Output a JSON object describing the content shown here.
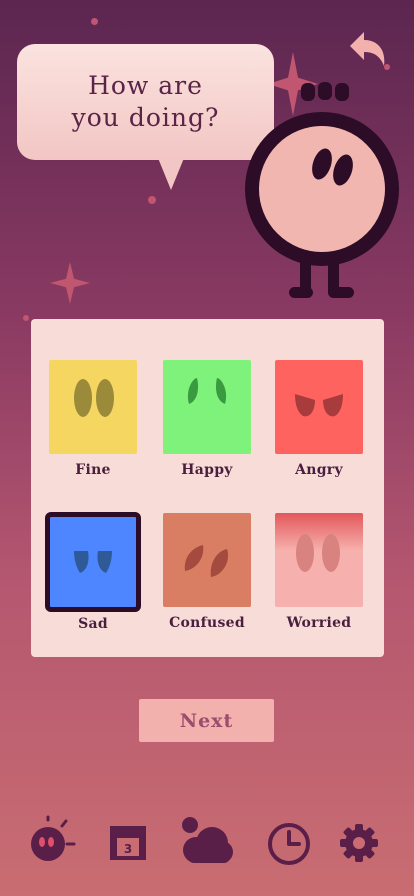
{
  "prompt": {
    "question": "How are you doing?"
  },
  "moods": [
    {
      "label": "Fine",
      "color": "#f5d660",
      "eye_color": "#9b8a3a",
      "icon": "fine-face-icon",
      "selected": false
    },
    {
      "label": "Happy",
      "color": "#7ef27a",
      "eye_color": "#3a9a40",
      "icon": "happy-face-icon",
      "selected": false
    },
    {
      "label": "Angry",
      "color": "#ff6360",
      "eye_color": "#a83c3c",
      "icon": "angry-face-icon",
      "selected": false
    },
    {
      "label": "Sad",
      "color": "#4d86ff",
      "eye_color": "#2f5a98",
      "icon": "sad-face-icon",
      "selected": true
    },
    {
      "label": "Confused",
      "color": "#d97e62",
      "eye_color": "#a44a3e",
      "icon": "confused-face-icon",
      "selected": false
    },
    {
      "label": "Worried",
      "color": "#f6b1ae",
      "eye_color": "#d8837f",
      "icon": "worried-face-icon",
      "selected": false
    }
  ],
  "actions": {
    "next_label": "Next"
  },
  "nav": {
    "calendar_day": "3",
    "items": [
      "mood-icon",
      "calendar-icon",
      "weather-icon",
      "history-clock-icon",
      "settings-gear-icon"
    ]
  },
  "colors": {
    "accent_dark": "#2c0c26",
    "panel": "#f8dcd8",
    "nav_icon": "#5a1f48"
  }
}
